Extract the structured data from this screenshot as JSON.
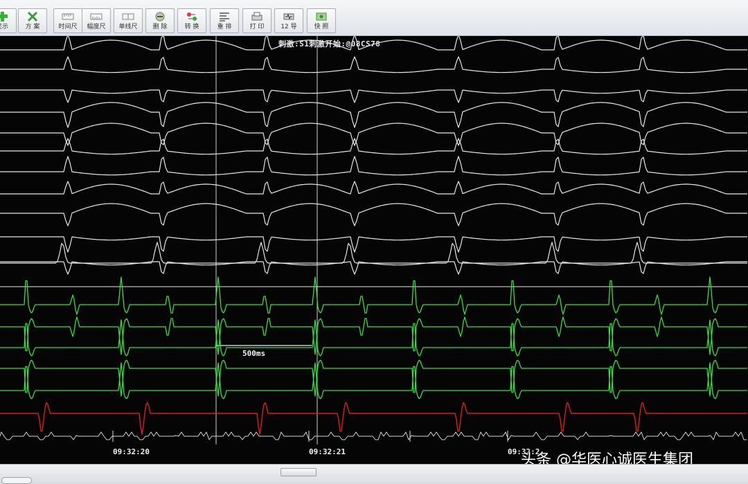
{
  "toolbar": {
    "buttons": [
      {
        "label": "显示",
        "icon": "green-plus-icon"
      },
      {
        "label": "方 案",
        "icon": "tools-icon"
      },
      {
        "label": "时间尺",
        "icon": "time-ruler-icon"
      },
      {
        "label": "幅度尺",
        "icon": "amplitude-ruler-icon"
      },
      {
        "label": "单线尺",
        "icon": "single-line-ruler-icon"
      },
      {
        "label": "删 除",
        "icon": "delete-icon"
      },
      {
        "label": "转 换",
        "icon": "convert-icon"
      },
      {
        "label": "重 排",
        "icon": "rearrange-icon"
      },
      {
        "label": "打 印",
        "icon": "print-icon"
      },
      {
        "label": "12 导",
        "icon": "twelve-lead-icon"
      },
      {
        "label": "快 照",
        "icon": "snapshot-icon"
      }
    ]
  },
  "screen": {
    "title": "刺激:S1刺激开始:@08CS78",
    "measure_label": "500ms",
    "time_labels": [
      "09:32:20",
      "09:32:21",
      "09:32:2"
    ],
    "watermark": "头条 @华医心诚医生集团"
  },
  "colors": {
    "surface_trace": "#e6e6e6",
    "intracardiac_trace": "#35e03a",
    "stim_trace": "#e01c1c",
    "background": "#050505"
  }
}
